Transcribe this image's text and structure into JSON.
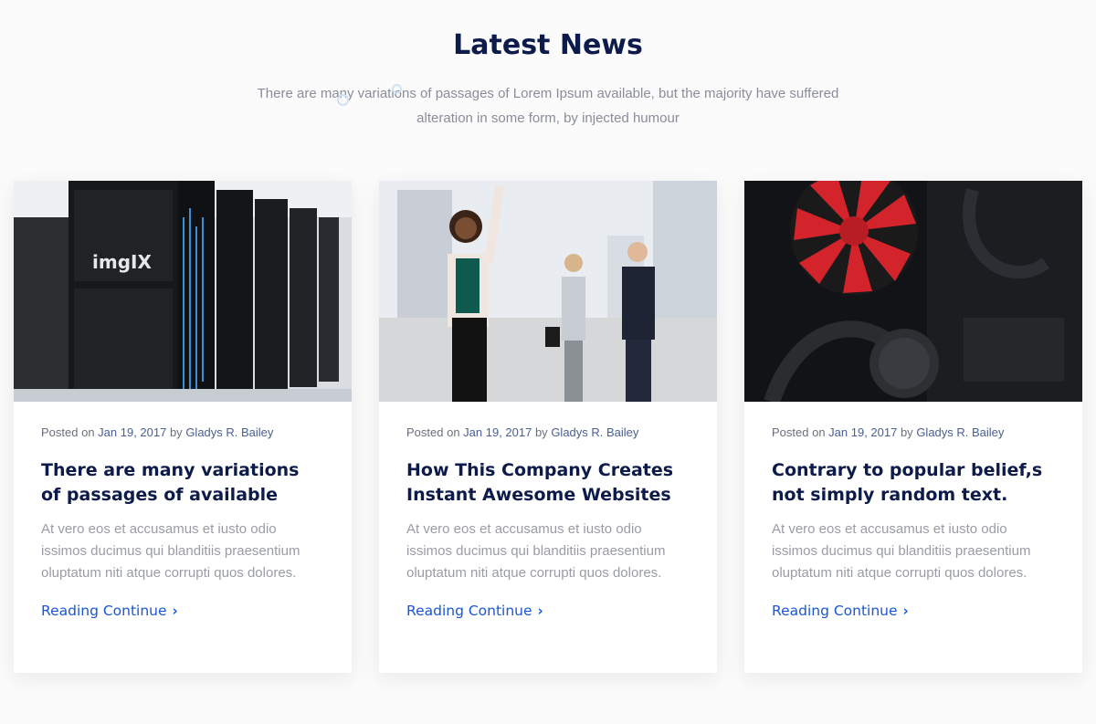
{
  "section": {
    "title": "Latest News",
    "subtitle": "There are many variations of passages of Lorem Ipsum available, but the majority have suffered alteration in some form, by injected humour"
  },
  "cards": [
    {
      "image": "server-room-photo",
      "image_text": "imgIX",
      "meta_prefix": "Posted on ",
      "date": "Jan 19, 2017",
      "meta_by": " by ",
      "author": "Gladys R. Bailey",
      "title": "There are many variations of passages of available",
      "excerpt": "At vero eos et accusamus et iusto odio issimos ducimus qui blanditiis praesentium oluptatum niti atque corrupti quos dolores.",
      "link_label": "Reading Continue"
    },
    {
      "image": "business-people-photo",
      "meta_prefix": "Posted on ",
      "date": "Jan 19, 2017",
      "meta_by": " by ",
      "author": "Gladys R. Bailey",
      "title": "How This Company Creates Instant Awesome Websites",
      "excerpt": "At vero eos et accusamus et iusto odio issimos ducimus qui blanditiis praesentium oluptatum niti atque corrupti quos dolores.",
      "link_label": "Reading Continue"
    },
    {
      "image": "pc-cooling-fan-photo",
      "meta_prefix": "Posted on ",
      "date": "Jan 19, 2017",
      "meta_by": " by ",
      "author": "Gladys R. Bailey",
      "title": "Contrary to popular belief,s not simply random text.",
      "excerpt": "At vero eos et accusamus et iusto odio issimos ducimus qui blanditiis praesentium oluptatum niti atque corrupti quos dolores.",
      "link_label": "Reading Continue"
    }
  ],
  "icons": {
    "read_more": "chevron-right-icon"
  },
  "colors": {
    "heading": "#0d1b4b",
    "link": "#1a56d6",
    "body_text": "#9a9ca5"
  }
}
